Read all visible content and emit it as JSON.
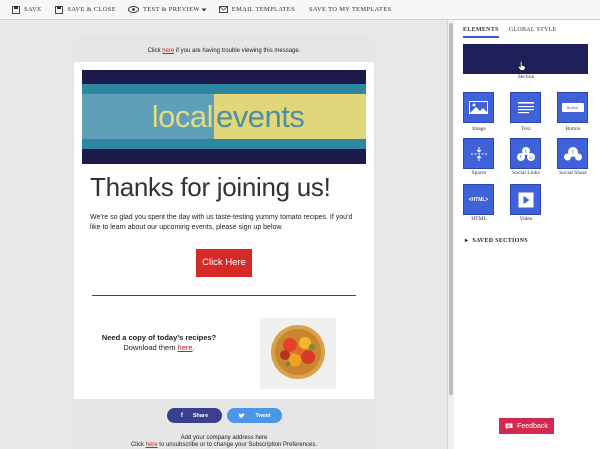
{
  "toolbar": {
    "save": "SAVE",
    "save_close": "SAVE & CLOSE",
    "test_preview": "TEST & PREVIEW",
    "email_templates": "EMAIL TEMPLATES",
    "save_to_templates": "SAVE TO MY TEMPLATES"
  },
  "email": {
    "trouble_prefix": "Click",
    "trouble_link": "here",
    "trouble_suffix": "if you are having trouble viewing this message.",
    "logo_left": "local",
    "logo_right": "events",
    "heading": "Thanks for joining us!",
    "body": "We’re so glad you spent the day with us taste-testing yummy tomato recipes. If you’d like to learn about our upcoming events, please sign up below.",
    "cta": "Click Here",
    "copy_question": "Need a copy of today’s recipes?",
    "copy_download_prefix": "Download them",
    "copy_download_link": "here",
    "share": "Share",
    "tweet": "Tweet",
    "address": "Add your company address here",
    "unsub_prefix": "Click",
    "unsub_link": "here",
    "unsub_suffix": "to unsubscribe or to change your Subscription Preferences."
  },
  "panel": {
    "tabs": [
      "ELEMENTS",
      "GLOBAL STYLE"
    ],
    "section_label": "Section",
    "elements": [
      "Image",
      "Text",
      "Button",
      "Spacer",
      "Social Links",
      "Social Share",
      "HTML",
      "Video"
    ],
    "button_tile_text": "Button",
    "html_tile_text": "<HTML>",
    "saved_sections": "SAVED SECTIONS"
  },
  "feedback": "Feedback",
  "colors": {
    "accent": "#3f62d9",
    "banner_dark": "#1b1a4a",
    "cta_red": "#d42b26",
    "feedback": "#d3294e",
    "share_btn": "#3b3f8f",
    "tweet_btn": "#4a97ea"
  }
}
